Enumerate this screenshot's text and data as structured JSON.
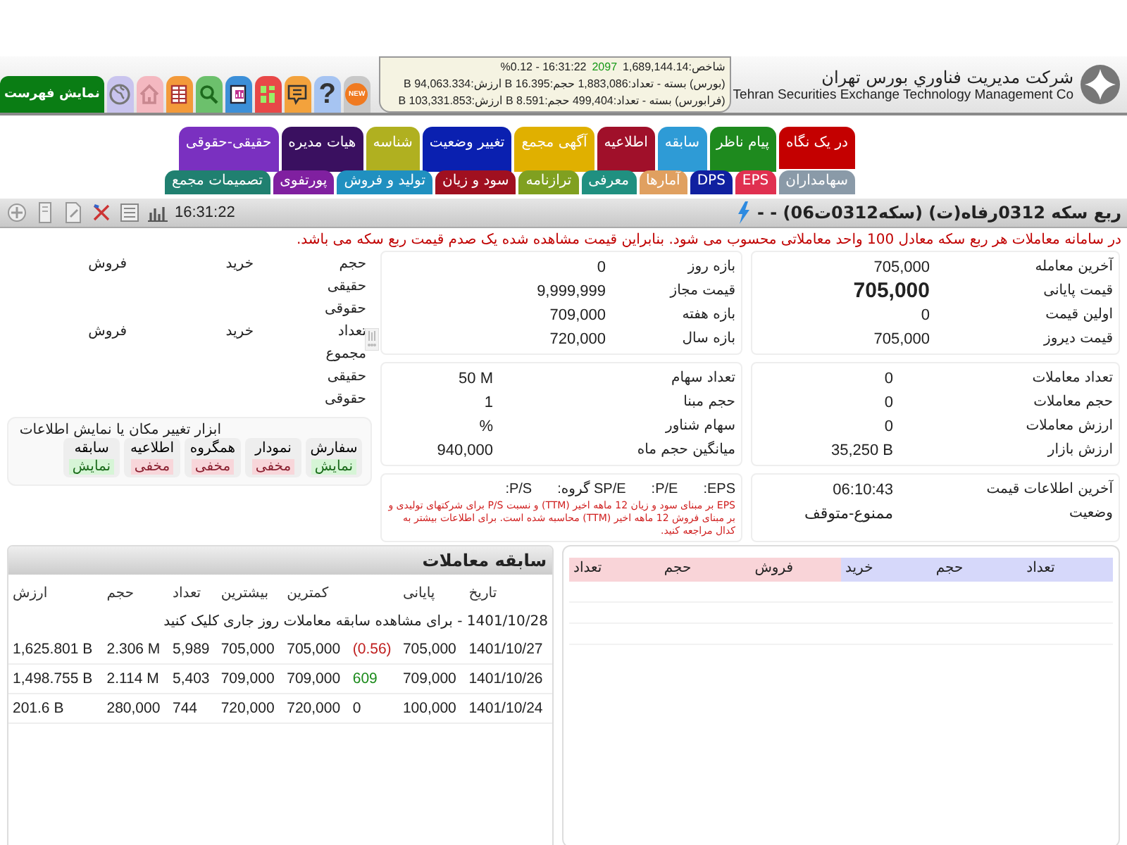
{
  "header": {
    "menu_button": "نمایش فهرست",
    "toolbar": [
      {
        "kind": "new",
        "label": "NEW"
      },
      {
        "kind": "help",
        "label": "?"
      },
      {
        "kind": "chat"
      },
      {
        "kind": "grid"
      },
      {
        "kind": "report"
      },
      {
        "kind": "search"
      },
      {
        "kind": "table"
      },
      {
        "kind": "home"
      },
      {
        "kind": "globe"
      }
    ],
    "market": {
      "index": "شاخص:1,689,144.14",
      "count": "2097",
      "time_change": "16:31:22 - %0.12",
      "lines": [
        "(بورس) بسته - تعداد:1,883,086 حجم:16.395 B ارزش:94,063.334 B",
        "(فرابورس) بسته - تعداد:499,404 حجم:8.591 B ارزش:103,331.853 B"
      ]
    },
    "company_fa": "شرکت مدیریت فناوري بورس تهران",
    "company_en": "Tehran Securities Exchange Technology Management Co"
  },
  "tabs": [
    [
      {
        "label": "در یک نگاه",
        "color": "#c40000",
        "selected": true
      },
      {
        "label": "پیام ناظر",
        "color": "#1e8a1e",
        "selected": false
      },
      {
        "label": "سابقه",
        "color": "#2e9bd6",
        "selected": false
      },
      {
        "label": "اطلاعیه",
        "color": "#a0102a",
        "selected": false
      },
      {
        "label": "آگهی مجمع",
        "color": "#e0b000",
        "selected": false
      },
      {
        "label": "تغییر وضعیت",
        "color": "#0a20b0",
        "selected": false
      },
      {
        "label": "شناسه",
        "color": "#b0b020",
        "selected": false
      },
      {
        "label": "هیات مدیره",
        "color": "#3a1060",
        "selected": false
      },
      {
        "label": "حقیقی-حقوقی",
        "color": "#7a30c0",
        "selected": false
      }
    ],
    [
      {
        "label": "سهامداران",
        "color": "#8a9aa8",
        "selected": false
      },
      {
        "label": "EPS",
        "color": "#e03050",
        "selected": false
      },
      {
        "label": "DPS",
        "color": "#1020a0",
        "selected": false
      },
      {
        "label": "آمارها",
        "color": "#e0a060",
        "selected": false
      },
      {
        "label": "معرفی",
        "color": "#209080",
        "selected": false
      },
      {
        "label": "ترازنامه",
        "color": "#80a020",
        "selected": false
      },
      {
        "label": "سود و زیان",
        "color": "#a01020",
        "selected": false
      },
      {
        "label": "تولید و فروش",
        "color": "#2090c0",
        "selected": false
      },
      {
        "label": "پورتفوی",
        "color": "#8020a0",
        "selected": false
      },
      {
        "label": "تصمیمات مجمع",
        "color": "#208070",
        "selected": false
      }
    ]
  ],
  "symbol": {
    "title": "ربع سکه 0312رفاه(ت) (سکه0312ت06) - -",
    "time": "16:31:22",
    "notice": "در سامانه معاملات هر ربع سکه معادل 100 واحد معاملاتی محسوب می شود. بنابراین قیمت مشاهده شده یک صدم قیمت ربع سکه می باشد."
  },
  "quote": {
    "prices": [
      {
        "label": "آخرین معامله",
        "value": "705,000",
        "kind": "plain"
      },
      {
        "label": "قیمت پایانی",
        "value": "705,000",
        "kind": "main"
      },
      {
        "label": "اولین قیمت",
        "value": "0",
        "kind": "plain"
      },
      {
        "label": "قیمت دیروز",
        "value": "705,000",
        "kind": "plain"
      }
    ],
    "ranges": [
      {
        "label": "بازه روز",
        "value": "0"
      },
      {
        "label": "قیمت مجاز",
        "value": "9,999,999"
      },
      {
        "label": "بازه هفته",
        "value": "709,000"
      },
      {
        "label": "بازه سال",
        "value": "720,000"
      }
    ],
    "trades": [
      {
        "label": "تعداد معاملات",
        "value": "0"
      },
      {
        "label": "حجم معاملات",
        "value": "0"
      },
      {
        "label": "ارزش معاملات",
        "value": "0"
      },
      {
        "label": "ارزش بازار",
        "value": "35,250 B"
      }
    ],
    "shares": [
      {
        "label": "تعداد سهام",
        "value": "50 M"
      },
      {
        "label": "حجم مبنا",
        "value": "1"
      },
      {
        "label": "سهام شناور",
        "value": "%"
      },
      {
        "label": "میانگین حجم ماه",
        "value": "940,000"
      }
    ],
    "status": [
      {
        "label": "آخرین اطلاعات قیمت",
        "value": "06:10:43"
      },
      {
        "label": "وضعیت",
        "value": "ممنوع-متوقف"
      }
    ],
    "ratios": [
      "EPS:",
      "P/E:",
      "SP/E گروه:",
      "P/S:"
    ],
    "ratio_note": "EPS بر مبنای سود و زیان 12 ماهه اخیر (TTM) و نسبت P/S برای شرکتهای تولیدی و بر مبنای فروش 12 ماهه اخیر (TTM) محاسبه شده است. برای اطلاعات بیشتر به کدال مراجعه کنید."
  },
  "client_types": [
    {
      "label": "حجم",
      "buy": "خرید",
      "sell": "فروش"
    },
    {
      "label": "حقیقی"
    },
    {
      "label": "حقوقی"
    },
    {
      "label": "تعداد",
      "buy": "خرید",
      "sell": "فروش"
    },
    {
      "label": "مجموع"
    },
    {
      "label": "حقیقی"
    },
    {
      "label": "حقوقی"
    }
  ],
  "layout_tools": {
    "title": "ابزار تغییر مکان یا نمایش اطلاعات",
    "items": [
      {
        "name": "سفارش",
        "state": "نمایش",
        "visible": true
      },
      {
        "name": "نمودار",
        "state": "مخفی",
        "visible": false
      },
      {
        "name": "همگروه",
        "state": "مخفی",
        "visible": false
      },
      {
        "name": "اطلاعیه",
        "state": "مخفی",
        "visible": false
      },
      {
        "name": "سابقه",
        "state": "نمایش",
        "visible": true
      }
    ]
  },
  "order_book": {
    "buy_columns": [
      "تعداد",
      "حجم",
      "خرید"
    ],
    "sell_columns": [
      "فروش",
      "حجم",
      "تعداد"
    ]
  },
  "history": {
    "title": "سابقه معاملات",
    "columns": {
      "date": "تاریخ",
      "close": "پایانی",
      "low": "کمترین",
      "high": "بیشترین",
      "count": "تعداد",
      "volume": "حجم",
      "value": "ارزش"
    },
    "today_link": "1401/10/28 - برای مشاهده سابقه معاملات روز جاری کلیک کنید",
    "rows": [
      {
        "date": "1401/10/27",
        "close": "705,000",
        "change": "(0.56)",
        "color": "#c02020",
        "low": "705,000",
        "high": "705,000",
        "count": "5,989",
        "volume": "2.306 M",
        "value": "1,625.801 B"
      },
      {
        "date": "1401/10/26",
        "close": "709,000",
        "change": "609",
        "color": "#1a8a1a",
        "low": "709,000",
        "high": "709,000",
        "count": "5,403",
        "volume": "2.114 M",
        "value": "1,498.755 B"
      },
      {
        "date": "1401/10/24",
        "close": "100,000",
        "change": "0",
        "color": "#222222",
        "low": "720,000",
        "high": "720,000",
        "count": "744",
        "volume": "280,000",
        "value": "201.6 B"
      }
    ]
  }
}
